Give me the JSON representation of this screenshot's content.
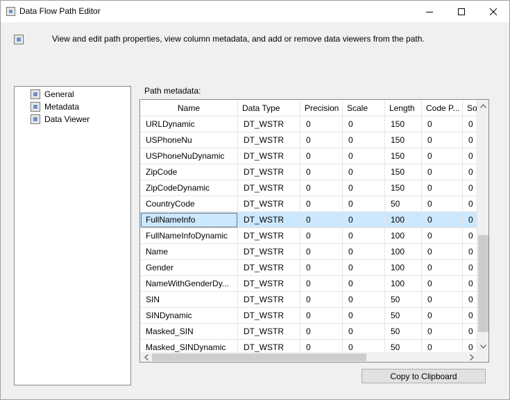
{
  "window": {
    "title": "Data Flow Path Editor",
    "minimize_icon": "minimize-icon",
    "maximize_icon": "maximize-icon",
    "close_icon": "close-icon"
  },
  "header": {
    "description": "View and edit path properties, view column metadata, and add or remove data viewers from the path."
  },
  "nav": {
    "items": [
      {
        "label": "General",
        "icon": "property-page-icon"
      },
      {
        "label": "Metadata",
        "icon": "property-page-icon",
        "selected": true
      },
      {
        "label": "Data Viewer",
        "icon": "property-page-icon"
      }
    ]
  },
  "grid": {
    "caption": "Path metadata:",
    "columns": [
      "Name",
      "Data Type",
      "Precision",
      "Scale",
      "Length",
      "Code P...",
      "So"
    ],
    "rows": [
      [
        "URLDynamic",
        "DT_WSTR",
        "0",
        "0",
        "150",
        "0",
        "0"
      ],
      [
        "USPhoneNu",
        "DT_WSTR",
        "0",
        "0",
        "150",
        "0",
        "0"
      ],
      [
        "USPhoneNuDynamic",
        "DT_WSTR",
        "0",
        "0",
        "150",
        "0",
        "0"
      ],
      [
        "ZipCode",
        "DT_WSTR",
        "0",
        "0",
        "150",
        "0",
        "0"
      ],
      [
        "ZipCodeDynamic",
        "DT_WSTR",
        "0",
        "0",
        "150",
        "0",
        "0"
      ],
      [
        "CountryCode",
        "DT_WSTR",
        "0",
        "0",
        "50",
        "0",
        "0"
      ],
      [
        "FullNameInfo",
        "DT_WSTR",
        "0",
        "0",
        "100",
        "0",
        "0"
      ],
      [
        "FullNameInfoDynamic",
        "DT_WSTR",
        "0",
        "0",
        "100",
        "0",
        "0"
      ],
      [
        "Name",
        "DT_WSTR",
        "0",
        "0",
        "100",
        "0",
        "0"
      ],
      [
        "Gender",
        "DT_WSTR",
        "0",
        "0",
        "100",
        "0",
        "0"
      ],
      [
        "NameWithGenderDy...",
        "DT_WSTR",
        "0",
        "0",
        "100",
        "0",
        "0"
      ],
      [
        "SIN",
        "DT_WSTR",
        "0",
        "0",
        "50",
        "0",
        "0"
      ],
      [
        "SINDynamic",
        "DT_WSTR",
        "0",
        "0",
        "50",
        "0",
        "0"
      ],
      [
        "Masked_SIN",
        "DT_WSTR",
        "0",
        "0",
        "50",
        "0",
        "0"
      ],
      [
        "Masked_SINDynamic",
        "DT_WSTR",
        "0",
        "0",
        "50",
        "0",
        "0"
      ]
    ],
    "selected_row_index": 6
  },
  "buttons": {
    "copy_to_clipboard": "Copy to Clipboard"
  },
  "colors": {
    "selection": "#cce8ff",
    "window_bg": "#f0f0f0"
  }
}
